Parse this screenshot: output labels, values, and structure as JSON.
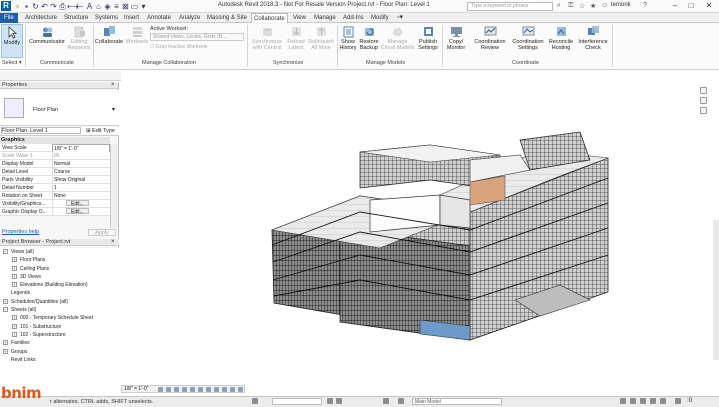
{
  "title_bar": {
    "app_logo": "R",
    "title": "Autodesk Revit 2018.3 - Not For Resale Version     Project.rvt - Floor Plan: Level 1",
    "search_placeholder": "Type a keyword or phrase",
    "username": "temonk",
    "window_buttons": [
      "–",
      "□",
      "✕"
    ]
  },
  "tabs": [
    "File",
    "Architecture",
    "Structure",
    "Systems",
    "Insert",
    "Annotate",
    "Analyze",
    "Massing & Site",
    "Collaborate",
    "View",
    "Manage",
    "Add-Ins",
    "Modify"
  ],
  "active_tab": "Collaborate",
  "ribbon": {
    "select": {
      "modify": "Modify",
      "select": "Select ▾"
    },
    "communicate": {
      "label": "Communicate",
      "communicator": "Communicator",
      "editing_requests_1": "Editing",
      "editing_requests_2": "Requests"
    },
    "manage_collab": {
      "label": "Manage Collaboration",
      "collaborate": "Collaborate",
      "worksets": "Worksets",
      "active_workset_label": "Active Workset:",
      "active_workset_value": "Shared Views, Levels, Grids (N...",
      "gray_inactive": "Gray Inactive Worksets"
    },
    "synchronize": {
      "label": "Synchronize",
      "sync_1": "Synchronize",
      "sync_2": "with Central",
      "reload_1": "Reload",
      "reload_2": "Latest",
      "relinquish_1": "Relinquish",
      "relinquish_2": "All Mine"
    },
    "manage_models": {
      "label": "Manage Models",
      "show_1": "Show",
      "show_2": "History",
      "restore_1": "Restore",
      "restore_2": "Backup",
      "mcm_1": "Manage",
      "mcm_2": "Cloud Models",
      "publish_1": "Publish",
      "publish_2": "Settings"
    },
    "coordinate": {
      "label": "Coordinate",
      "copy_1": "Copy/",
      "copy_2": "Monitor",
      "review_1": "Coordination",
      "review_2": "Review",
      "settings_1": "Coordination",
      "settings_2": "Settings",
      "reconcile_1": "Reconcile",
      "reconcile_2": "Hosting",
      "interference_1": "Interference",
      "interference_2": "Check"
    }
  },
  "properties": {
    "title": "Properties",
    "type_name": "Floor Plan",
    "instance_selector": "Floor Plan: Level 1",
    "edit_type": "Edit Type",
    "group": "Graphics",
    "rows": [
      {
        "k": "View Scale",
        "v": "1/8\" = 1'-0\""
      },
      {
        "k": "Scale Value   1:",
        "v": "96"
      },
      {
        "k": "Display Model",
        "v": "Normal"
      },
      {
        "k": "Detail Level",
        "v": "Coarse"
      },
      {
        "k": "Parts Visibility",
        "v": "Show Original"
      },
      {
        "k": "Detail Number",
        "v": "1"
      },
      {
        "k": "Rotation on Sheet",
        "v": "None"
      },
      {
        "k": "Visibility/Graphics...",
        "v": "Edit..."
      },
      {
        "k": "Graphic Display O...",
        "v": "Edit..."
      }
    ],
    "help": "Properties help",
    "apply": "Apply"
  },
  "project_browser": {
    "title": "Project Browser - Project.rvt",
    "items": [
      {
        "label": "Views (all)",
        "level": 0,
        "toggle": "−"
      },
      {
        "label": "Floor Plans",
        "level": 1,
        "toggle": "+"
      },
      {
        "label": "Ceiling Plans",
        "level": 1,
        "toggle": "+"
      },
      {
        "label": "3D Views",
        "level": 1,
        "toggle": "+"
      },
      {
        "label": "Elevations (Building Elevation)",
        "level": 1,
        "toggle": "+"
      },
      {
        "label": "Legends",
        "level": 0,
        "toggle": ""
      },
      {
        "label": "Schedules/Quantities (all)",
        "level": 0,
        "toggle": "+"
      },
      {
        "label": "Sheets (all)",
        "level": 0,
        "toggle": "−"
      },
      {
        "label": "000 - Temporary Schedule Sheet",
        "level": 1,
        "toggle": "+"
      },
      {
        "label": "101 - Substructure",
        "level": 1,
        "toggle": "+"
      },
      {
        "label": "102 - Superstructure",
        "level": 1,
        "toggle": "+"
      },
      {
        "label": "Families",
        "level": 0,
        "toggle": "+"
      },
      {
        "label": "Groups",
        "level": 0,
        "toggle": "+"
      },
      {
        "label": "Revit Links",
        "level": 0,
        "toggle": ""
      }
    ]
  },
  "view_control": {
    "scale": "1/8\" = 1'-0\""
  },
  "status_bar": {
    "message": "r alternates, CTRL adds, SHIFT unselects.",
    "model": "Main Model",
    "watermark": "bnim"
  },
  "colors": {
    "file_tab": "#1f5fa8",
    "accent": "#1a58b0",
    "watermark": "#e0561b"
  }
}
